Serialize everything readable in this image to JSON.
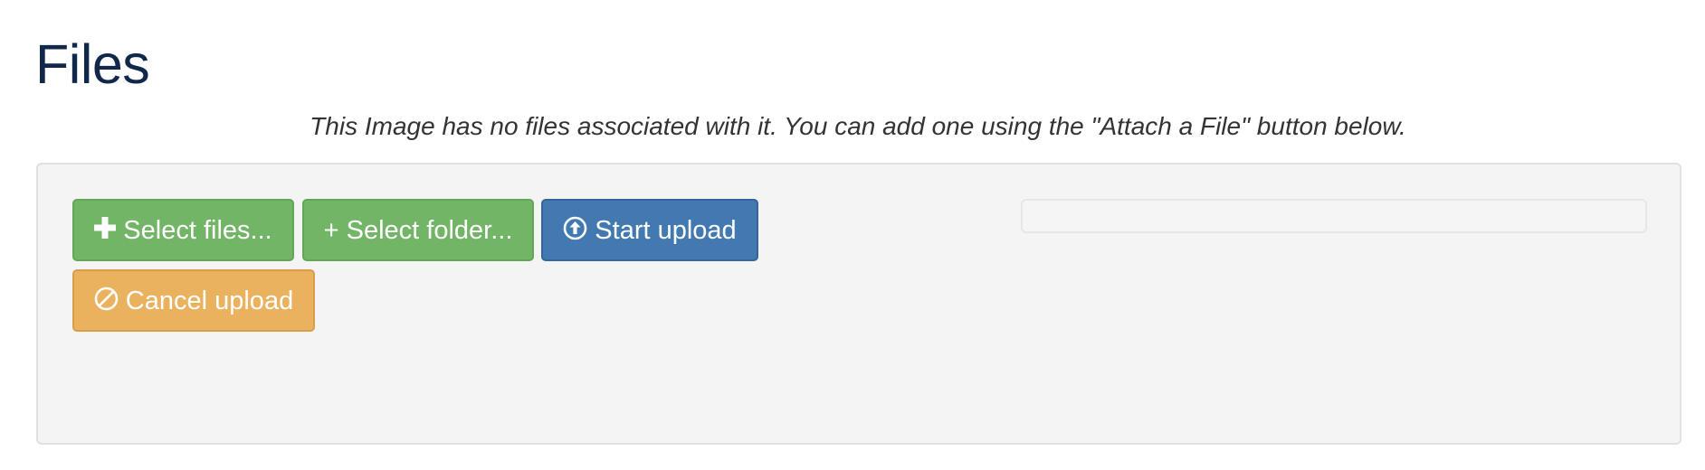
{
  "page": {
    "title": "Files",
    "empty_notice": "This Image has no files associated with it. You can add one using the \"Attach a File\" button below."
  },
  "uploader": {
    "select_files_label": "Select files...",
    "select_folder_label": "+ Select folder...",
    "start_upload_label": "Start upload",
    "cancel_upload_label": "Cancel upload",
    "progress_fraction": 0,
    "icons": {
      "select_files": "plus-icon",
      "start_upload": "upload-circle-icon",
      "cancel_upload": "ban-circle-icon"
    }
  },
  "colors": {
    "title": "#12284b",
    "success": "#72b566",
    "primary": "#4379b1",
    "warning": "#eab25f",
    "panel_background": "#f4f4f4"
  }
}
